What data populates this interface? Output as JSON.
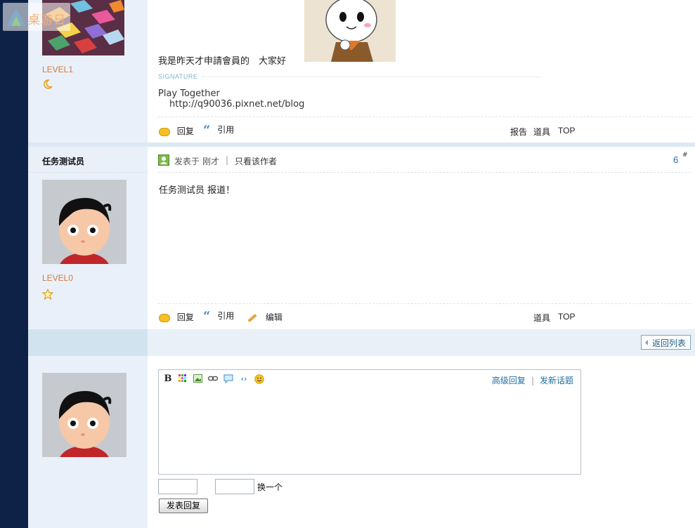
{
  "watermark": {
    "text": "桌游日"
  },
  "post1": {
    "level": "LEVEL1",
    "text": "我是昨天才申請會員的　大家好",
    "signature_label": "SIGNATURE",
    "signature_line1": "Play Together",
    "signature_line2": "http://q90036.pixnet.net/blog",
    "actions": {
      "reply": "回复",
      "quote": "引用"
    },
    "right_actions": {
      "report": "报告",
      "tools": "道具",
      "top": "TOP"
    }
  },
  "post2": {
    "author": "任务测试员",
    "posted_label": "发表于",
    "posted_time": "刚才",
    "divider": "|",
    "only_author": "只看该作者",
    "floor": "6",
    "floor_suffix": "#",
    "text": "任务测试员 报道！",
    "level": "LEVEL0",
    "actions": {
      "reply": "回复",
      "quote": "引用",
      "edit": "编辑"
    },
    "right_actions": {
      "tools": "道具",
      "top": "TOP"
    }
  },
  "return_button": "返回列表",
  "editor": {
    "toolbar_bold": "B",
    "advanced_reply": "高级回复",
    "divider": "|",
    "new_topic": "发新话题",
    "captcha_refresh": "换一个",
    "submit": "发表回复"
  },
  "colors": {
    "left_bar": "#0e2248",
    "author_bg": "#e9f0f9",
    "accent_link": "#1f6f9f",
    "level": "#d6793a"
  }
}
